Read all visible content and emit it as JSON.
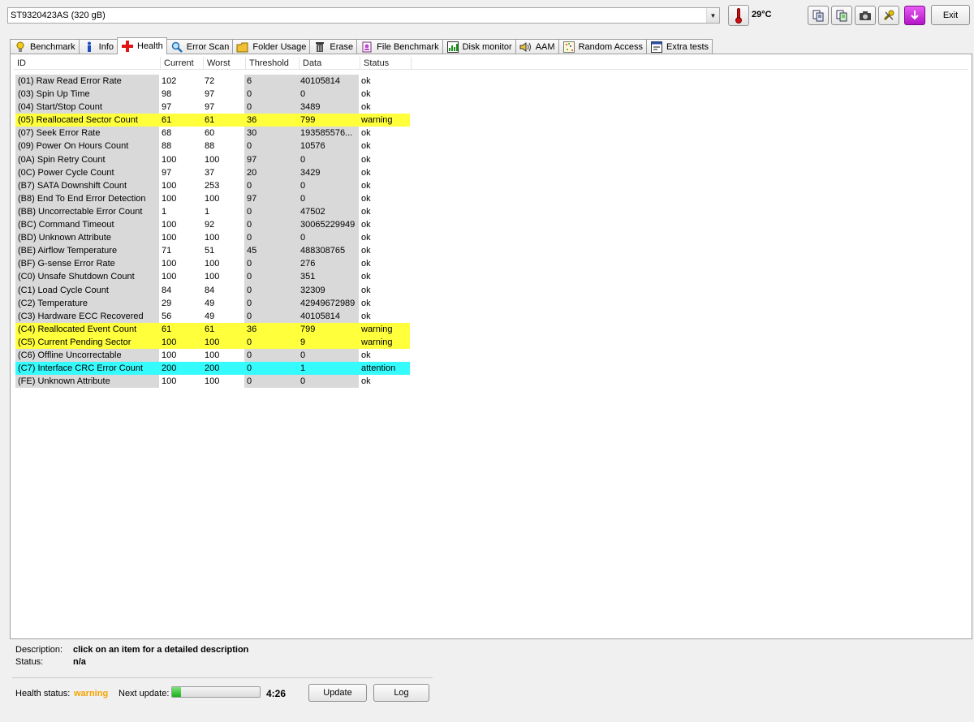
{
  "drive": {
    "selected": "ST9320423AS (320 gB)"
  },
  "temperature": "29°C",
  "toolbar": {
    "exit_label": "Exit"
  },
  "tabs": [
    {
      "label": "Benchmark",
      "icon": "lightbulb-icon"
    },
    {
      "label": "Info",
      "icon": "info-icon"
    },
    {
      "label": "Health",
      "icon": "red-cross-icon",
      "active": true
    },
    {
      "label": "Error Scan",
      "icon": "magnifier-icon"
    },
    {
      "label": "Folder Usage",
      "icon": "folder-icon"
    },
    {
      "label": "Erase",
      "icon": "trash-icon"
    },
    {
      "label": "File Benchmark",
      "icon": "file-icon"
    },
    {
      "label": "Disk monitor",
      "icon": "chart-icon"
    },
    {
      "label": "AAM",
      "icon": "speaker-icon"
    },
    {
      "label": "Random Access",
      "icon": "dots-grid-icon"
    },
    {
      "label": "Extra tests",
      "icon": "window-icon"
    }
  ],
  "columns": [
    "ID",
    "Current",
    "Worst",
    "Threshold",
    "Data",
    "Status"
  ],
  "rows": [
    {
      "id": "(01) Raw Read Error Rate",
      "current": "102",
      "worst": "72",
      "threshold": "6",
      "data": "40105814",
      "status": "ok"
    },
    {
      "id": "(03) Spin Up Time",
      "current": "98",
      "worst": "97",
      "threshold": "0",
      "data": "0",
      "status": "ok"
    },
    {
      "id": "(04) Start/Stop Count",
      "current": "97",
      "worst": "97",
      "threshold": "0",
      "data": "3489",
      "status": "ok"
    },
    {
      "id": "(05) Reallocated Sector Count",
      "current": "61",
      "worst": "61",
      "threshold": "36",
      "data": "799",
      "status": "warning"
    },
    {
      "id": "(07) Seek Error Rate",
      "current": "68",
      "worst": "60",
      "threshold": "30",
      "data": "193585576...",
      "status": "ok"
    },
    {
      "id": "(09) Power On Hours Count",
      "current": "88",
      "worst": "88",
      "threshold": "0",
      "data": "10576",
      "status": "ok"
    },
    {
      "id": "(0A) Spin Retry Count",
      "current": "100",
      "worst": "100",
      "threshold": "97",
      "data": "0",
      "status": "ok"
    },
    {
      "id": "(0C) Power Cycle Count",
      "current": "97",
      "worst": "37",
      "threshold": "20",
      "data": "3429",
      "status": "ok"
    },
    {
      "id": "(B7) SATA Downshift Count",
      "current": "100",
      "worst": "253",
      "threshold": "0",
      "data": "0",
      "status": "ok"
    },
    {
      "id": "(B8) End To End Error Detection",
      "current": "100",
      "worst": "100",
      "threshold": "97",
      "data": "0",
      "status": "ok"
    },
    {
      "id": "(BB) Uncorrectable Error Count",
      "current": "1",
      "worst": "1",
      "threshold": "0",
      "data": "47502",
      "status": "ok"
    },
    {
      "id": "(BC) Command Timeout",
      "current": "100",
      "worst": "92",
      "threshold": "0",
      "data": "30065229949",
      "status": "ok"
    },
    {
      "id": "(BD) Unknown Attribute",
      "current": "100",
      "worst": "100",
      "threshold": "0",
      "data": "0",
      "status": "ok"
    },
    {
      "id": "(BE) Airflow Temperature",
      "current": "71",
      "worst": "51",
      "threshold": "45",
      "data": "488308765",
      "status": "ok"
    },
    {
      "id": "(BF) G-sense Error Rate",
      "current": "100",
      "worst": "100",
      "threshold": "0",
      "data": "276",
      "status": "ok"
    },
    {
      "id": "(C0) Unsafe Shutdown Count",
      "current": "100",
      "worst": "100",
      "threshold": "0",
      "data": "351",
      "status": "ok"
    },
    {
      "id": "(C1) Load Cycle Count",
      "current": "84",
      "worst": "84",
      "threshold": "0",
      "data": "32309",
      "status": "ok"
    },
    {
      "id": "(C2) Temperature",
      "current": "29",
      "worst": "49",
      "threshold": "0",
      "data": "42949672989",
      "status": "ok"
    },
    {
      "id": "(C3) Hardware ECC Recovered",
      "current": "56",
      "worst": "49",
      "threshold": "0",
      "data": "40105814",
      "status": "ok"
    },
    {
      "id": "(C4) Reallocated Event Count",
      "current": "61",
      "worst": "61",
      "threshold": "36",
      "data": "799",
      "status": "warning"
    },
    {
      "id": "(C5) Current Pending Sector",
      "current": "100",
      "worst": "100",
      "threshold": "0",
      "data": "9",
      "status": "warning"
    },
    {
      "id": "(C6) Offline Uncorrectable",
      "current": "100",
      "worst": "100",
      "threshold": "0",
      "data": "0",
      "status": "ok"
    },
    {
      "id": "(C7) Interface CRC Error Count",
      "current": "200",
      "worst": "200",
      "threshold": "0",
      "data": "1",
      "status": "attention"
    },
    {
      "id": "(FE) Unknown Attribute",
      "current": "100",
      "worst": "100",
      "threshold": "0",
      "data": "0",
      "status": "ok"
    }
  ],
  "bottom": {
    "description_label": "Description:",
    "description_value": "click on an item for a detailed description",
    "status_label": "Status:",
    "status_value": "n/a",
    "health_label": "Health status:",
    "health_value": "warning",
    "next_update_label": "Next update:",
    "next_update_progress": 0.1,
    "countdown": "4:26",
    "update_label": "Update",
    "log_label": "Log"
  },
  "colors": {
    "warning_row": "#ffff3b",
    "attention_row": "#35fbfd",
    "health_warning": "#f5a400"
  }
}
